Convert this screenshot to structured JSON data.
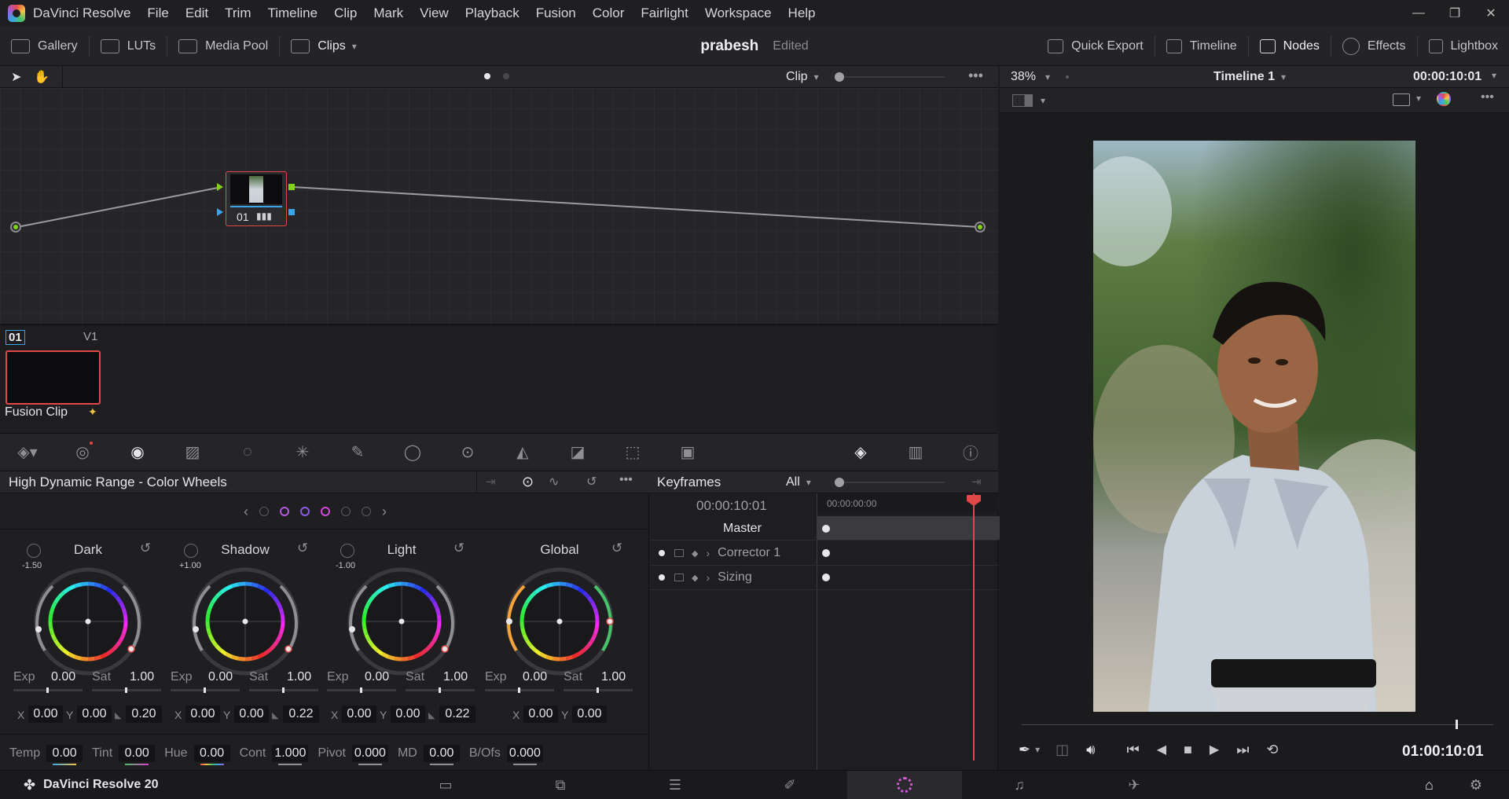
{
  "menu": {
    "items": [
      "DaVinci Resolve",
      "File",
      "Edit",
      "Trim",
      "Timeline",
      "Clip",
      "Mark",
      "View",
      "Playback",
      "Fusion",
      "Color",
      "Fairlight",
      "Workspace",
      "Help"
    ]
  },
  "toolbar": {
    "gallery": "Gallery",
    "luts": "LUTs",
    "media_pool": "Media Pool",
    "clips": "Clips",
    "project_name": "prabesh",
    "project_state": "Edited",
    "quick_export": "Quick Export",
    "timeline": "Timeline",
    "nodes": "Nodes",
    "effects": "Effects",
    "lightbox": "Lightbox"
  },
  "node_editor": {
    "mode": "Clip",
    "node_label": "01"
  },
  "clip_strip": {
    "clip_number": "01",
    "track": "V1",
    "clip_name": "Fusion Clip"
  },
  "wheels": {
    "title": "High Dynamic Range - Color Wheels",
    "zones": [
      {
        "name": "Dark",
        "zone_value": "-1.50",
        "exp": "0.00",
        "sat": "1.00",
        "x": "0.00",
        "y": "0.00",
        "falloff": "0.20"
      },
      {
        "name": "Shadow",
        "zone_value": "+1.00",
        "exp": "0.00",
        "sat": "1.00",
        "x": "0.00",
        "y": "0.00",
        "falloff": "0.22"
      },
      {
        "name": "Light",
        "zone_value": "-1.00",
        "exp": "0.00",
        "sat": "1.00",
        "x": "0.00",
        "y": "0.00",
        "falloff": "0.22"
      },
      {
        "name": "Global",
        "zone_value": "",
        "exp": "0.00",
        "sat": "1.00",
        "x": "0.00",
        "y": "0.00",
        "falloff": ""
      }
    ],
    "labels": {
      "exp": "Exp",
      "sat": "Sat",
      "x": "X",
      "y": "Y"
    },
    "bottom": [
      {
        "label": "Temp",
        "value": "0.00"
      },
      {
        "label": "Tint",
        "value": "0.00"
      },
      {
        "label": "Hue",
        "value": "0.00"
      },
      {
        "label": "Cont",
        "value": "1.000"
      },
      {
        "label": "Pivot",
        "value": "0.000"
      },
      {
        "label": "MD",
        "value": "0.00"
      },
      {
        "label": "B/Ofs",
        "value": "0.000"
      }
    ]
  },
  "keyframes": {
    "title": "Keyframes",
    "filter": "All",
    "timecode": "00:00:10:01",
    "ruler_start": "00:00:00:00",
    "tracks": [
      "Master",
      "Corrector 1",
      "Sizing"
    ]
  },
  "viewer": {
    "zoom": "38%",
    "timeline_name": "Timeline 1",
    "timecode_top": "00:00:10:01",
    "timecode_bottom": "01:00:10:01",
    "scrub_position": 0.92
  },
  "pagebar": {
    "app_name": "DaVinci Resolve 20",
    "active_page": "color"
  }
}
